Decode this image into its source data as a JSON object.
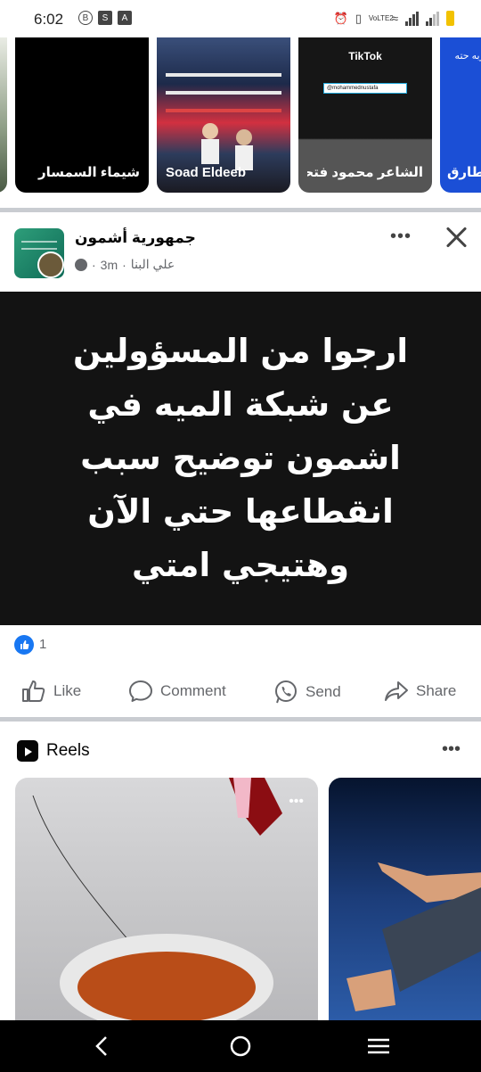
{
  "status_bar": {
    "time": "6:02",
    "network_label": "VoLTE2",
    "icons": [
      "alarm-icon",
      "vibrate-icon",
      "wifi-icon",
      "signal-icon",
      "battery-icon"
    ]
  },
  "stories": [
    {
      "label": ""
    },
    {
      "label": "شيماء السمسار"
    },
    {
      "label": "Soad Eldeeb"
    },
    {
      "label": "الشاعر محمود فتحى",
      "overlay_brand": "TikTok",
      "overlay_handle": "@mohammednustafa"
    },
    {
      "label": "طارق",
      "top_text": "ضربه حته"
    }
  ],
  "post": {
    "author": "جمهورية أشمون",
    "subtitle": "علي البنا",
    "time": "3m",
    "text": "ارجوا من المسؤولين عن شبكة الميه في اشمون توضيح سبب انقطاعها حتي الآن وهتيجي امتي",
    "background_color": "#131313",
    "reaction_count": "1",
    "actions": {
      "like": "Like",
      "comment": "Comment",
      "send": "Send",
      "share": "Share"
    }
  },
  "reels": {
    "title": "Reels"
  },
  "colors": {
    "accent": "#1877f2",
    "secondary_text": "#65676b",
    "divider": "#c9ccd1"
  }
}
